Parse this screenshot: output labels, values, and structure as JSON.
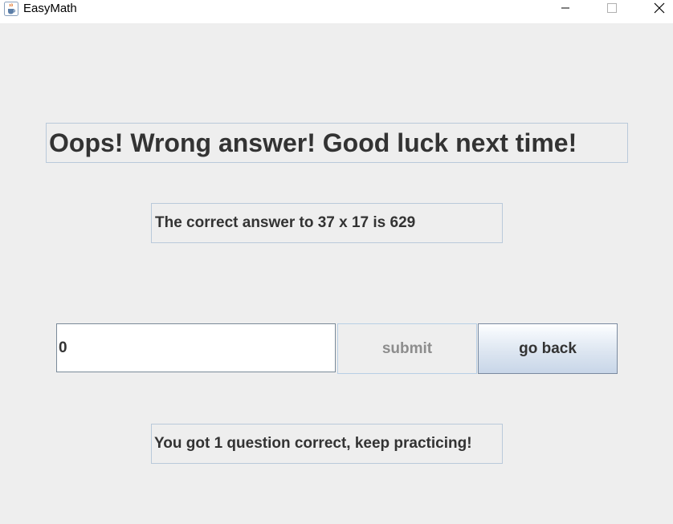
{
  "window": {
    "title": "EasyMath",
    "app_icon": "java-coffee-cup-icon",
    "controls": {
      "minimize_icon": "minimize-icon",
      "maximize_icon": "maximize-icon",
      "close_icon": "close-icon"
    }
  },
  "result": {
    "title": "Oops! Wrong answer! Good luck next time!",
    "correct_answer_text": "The correct answer to 37 x 17 is 629",
    "score_text": "You got 1 question correct, keep practicing!"
  },
  "answer_form": {
    "input_value": "0",
    "submit_label": "submit",
    "submit_enabled": false,
    "go_back_label": "go back"
  },
  "colors": {
    "background": "#eeeeee",
    "text": "#333333",
    "label_border": "#b9c9da",
    "disabled_text": "#8d8d8d",
    "button_gradient_bottom": "#c8d6e8"
  }
}
